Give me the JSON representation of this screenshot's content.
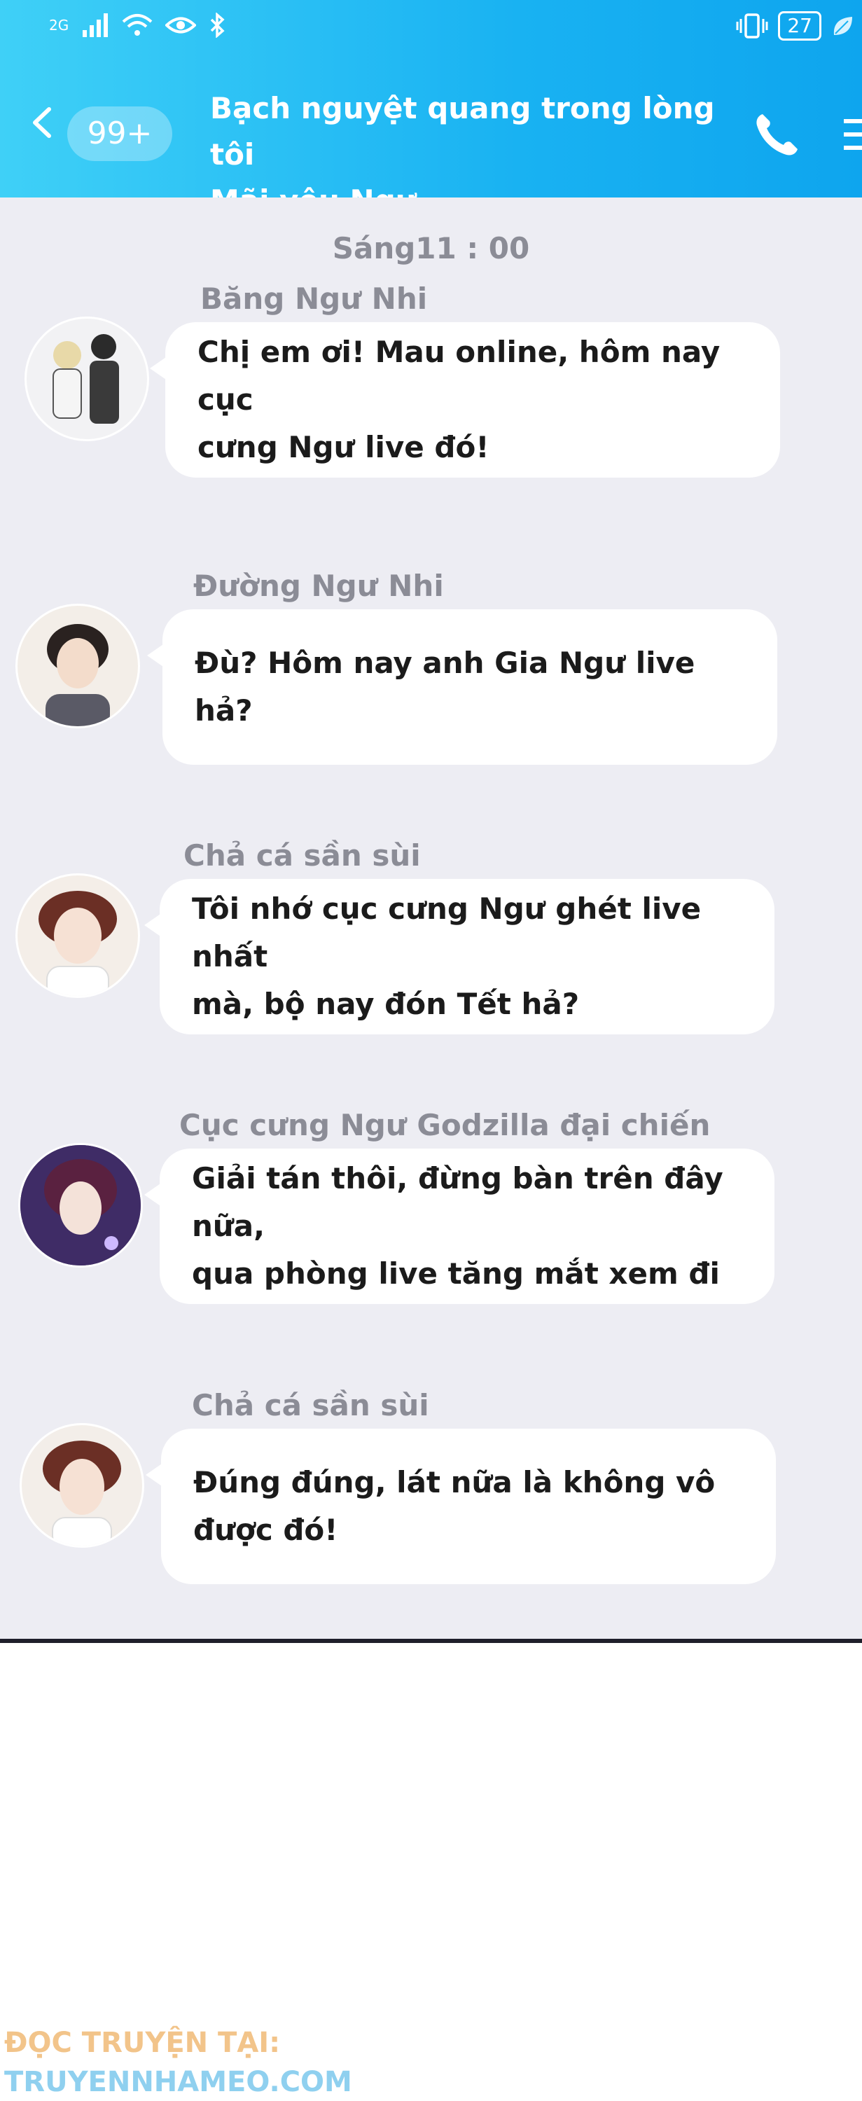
{
  "status_bar": {
    "network": "2G",
    "battery": "27",
    "icons": [
      "signal-icon",
      "wifi-icon",
      "eye-icon",
      "bluetooth-icon",
      "vibrate-icon",
      "battery-icon",
      "leaf-icon"
    ]
  },
  "header": {
    "unread_badge": "99+",
    "title_line1": "Bạch nguyệt quang trong lòng tôi",
    "title_line2": "Mãi yêu Ngư"
  },
  "chat": {
    "timestamp": "Sáng11 : 00",
    "messages": [
      {
        "sender": "Băng Ngư Nhi",
        "lines": [
          "Chị em ơi! Mau online, hôm nay cục",
          "cưng Ngư live đó!"
        ]
      },
      {
        "sender": "Đường Ngư Nhi",
        "lines": [
          "Đù? Hôm nay anh Gia Ngư live hả?"
        ]
      },
      {
        "sender": "Chả cá sần sùi",
        "lines": [
          "Tôi nhớ cục cưng Ngư ghét live nhất",
          "mà, bộ nay đón Tết hả?"
        ]
      },
      {
        "sender": "Cục cưng Ngư Godzilla đại chiến",
        "lines": [
          "Giải tán thôi, đừng bàn trên đây nữa,",
          "qua phòng live tăng mắt xem đi"
        ]
      },
      {
        "sender": "Chả cá sần sùi",
        "lines": [
          "Đúng đúng, lát nữa là không vô",
          "được đó!"
        ]
      }
    ]
  },
  "footer": {
    "line1": "ĐỌC TRUYỆN TẠI:",
    "line2": "TRUYENNHAMEO.COM"
  },
  "colors": {
    "header_blue": "#19b2f2",
    "chat_background": "#ededf3",
    "bubble": "#ffffff",
    "footer_orange": "#f2c48a",
    "footer_blue": "#8fd0ef"
  }
}
